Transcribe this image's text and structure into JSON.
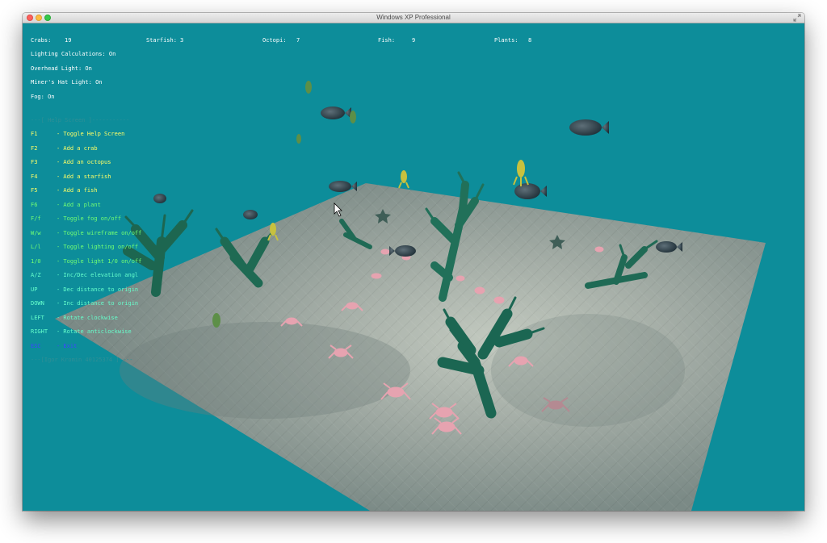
{
  "window": {
    "title": "Windows XP Professional"
  },
  "stats": {
    "crabs": {
      "label": "Crabs:",
      "value": "19"
    },
    "starfish": {
      "label": "Starfish:",
      "value": "3"
    },
    "octopi": {
      "label": "Octopi:",
      "value": "7"
    },
    "fish": {
      "label": "Fish:",
      "value": "9"
    },
    "plants": {
      "label": "Plants:",
      "value": "8"
    }
  },
  "status_lines": [
    "Lighting Calculations: On",
    "Overhead Light: On",
    "Miner's Hat Light: On",
    "Fog: On"
  ],
  "help": {
    "header": "---[ Help Screen ]-----------",
    "items": [
      {
        "key": "F1",
        "desc": "- Toggle Help Screen"
      },
      {
        "key": "F2",
        "desc": "- Add a crab"
      },
      {
        "key": "F3",
        "desc": "- Add an octopus"
      },
      {
        "key": "F4",
        "desc": "- Add a starfish"
      },
      {
        "key": "F5",
        "desc": "- Add a fish"
      },
      {
        "key": "F6",
        "desc": "- Add a plant"
      },
      {
        "key": "F/f",
        "desc": "- Toggle fog on/off"
      },
      {
        "key": "W/w",
        "desc": "- Toggle wireframe on/off"
      },
      {
        "key": "L/l",
        "desc": "- Toggle lighting on/off"
      },
      {
        "key": "1/0",
        "desc": "- Toggle light 1/0 on/off"
      },
      {
        "key": "A/Z",
        "desc": "- Inc/Dec elevation angl"
      },
      {
        "key": "UP",
        "desc": "- Dec distance to origin"
      },
      {
        "key": "DOWN",
        "desc": "- Inc distance to origin"
      },
      {
        "key": "LEFT",
        "desc": "- Rotate clockwise"
      },
      {
        "key": "RIGHT",
        "desc": "- Rotate anticlockwise"
      },
      {
        "key": "ESC",
        "desc": "- Exit"
      }
    ],
    "footer": "---[Igor Kromin 40125374 ]----"
  },
  "colors": {
    "water": "#0d8d9a",
    "floor": "#9aa49d",
    "plant": "#1f6b55",
    "crab": "#e6a3b0",
    "help_yellow": "#ffff66",
    "help_green": "#73ff73",
    "help_cyan": "#66ffcc",
    "help_blue": "#3c46ff"
  }
}
